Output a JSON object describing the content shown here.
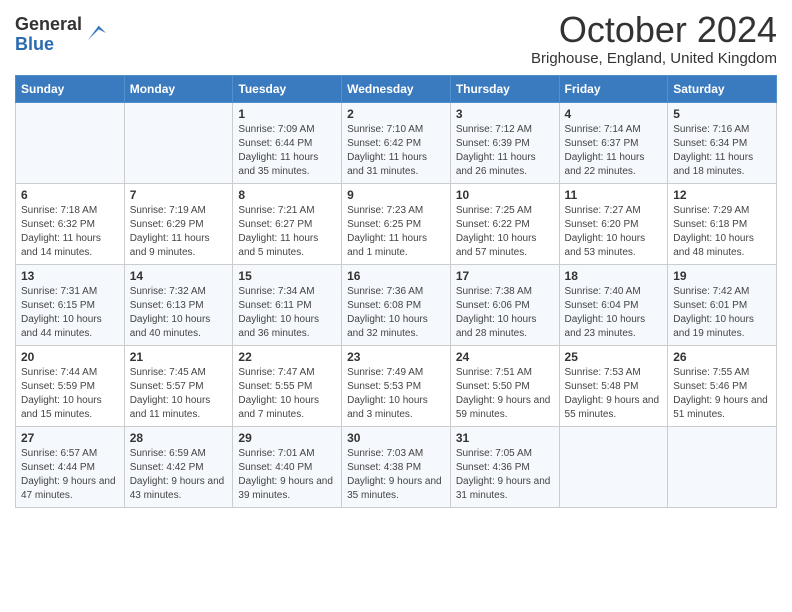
{
  "logo": {
    "general": "General",
    "blue": "Blue"
  },
  "header": {
    "month": "October 2024",
    "location": "Brighouse, England, United Kingdom"
  },
  "weekdays": [
    "Sunday",
    "Monday",
    "Tuesday",
    "Wednesday",
    "Thursday",
    "Friday",
    "Saturday"
  ],
  "weeks": [
    [
      {
        "day": "",
        "info": ""
      },
      {
        "day": "",
        "info": ""
      },
      {
        "day": "1",
        "info": "Sunrise: 7:09 AM\nSunset: 6:44 PM\nDaylight: 11 hours and 35 minutes."
      },
      {
        "day": "2",
        "info": "Sunrise: 7:10 AM\nSunset: 6:42 PM\nDaylight: 11 hours and 31 minutes."
      },
      {
        "day": "3",
        "info": "Sunrise: 7:12 AM\nSunset: 6:39 PM\nDaylight: 11 hours and 26 minutes."
      },
      {
        "day": "4",
        "info": "Sunrise: 7:14 AM\nSunset: 6:37 PM\nDaylight: 11 hours and 22 minutes."
      },
      {
        "day": "5",
        "info": "Sunrise: 7:16 AM\nSunset: 6:34 PM\nDaylight: 11 hours and 18 minutes."
      }
    ],
    [
      {
        "day": "6",
        "info": "Sunrise: 7:18 AM\nSunset: 6:32 PM\nDaylight: 11 hours and 14 minutes."
      },
      {
        "day": "7",
        "info": "Sunrise: 7:19 AM\nSunset: 6:29 PM\nDaylight: 11 hours and 9 minutes."
      },
      {
        "day": "8",
        "info": "Sunrise: 7:21 AM\nSunset: 6:27 PM\nDaylight: 11 hours and 5 minutes."
      },
      {
        "day": "9",
        "info": "Sunrise: 7:23 AM\nSunset: 6:25 PM\nDaylight: 11 hours and 1 minute."
      },
      {
        "day": "10",
        "info": "Sunrise: 7:25 AM\nSunset: 6:22 PM\nDaylight: 10 hours and 57 minutes."
      },
      {
        "day": "11",
        "info": "Sunrise: 7:27 AM\nSunset: 6:20 PM\nDaylight: 10 hours and 53 minutes."
      },
      {
        "day": "12",
        "info": "Sunrise: 7:29 AM\nSunset: 6:18 PM\nDaylight: 10 hours and 48 minutes."
      }
    ],
    [
      {
        "day": "13",
        "info": "Sunrise: 7:31 AM\nSunset: 6:15 PM\nDaylight: 10 hours and 44 minutes."
      },
      {
        "day": "14",
        "info": "Sunrise: 7:32 AM\nSunset: 6:13 PM\nDaylight: 10 hours and 40 minutes."
      },
      {
        "day": "15",
        "info": "Sunrise: 7:34 AM\nSunset: 6:11 PM\nDaylight: 10 hours and 36 minutes."
      },
      {
        "day": "16",
        "info": "Sunrise: 7:36 AM\nSunset: 6:08 PM\nDaylight: 10 hours and 32 minutes."
      },
      {
        "day": "17",
        "info": "Sunrise: 7:38 AM\nSunset: 6:06 PM\nDaylight: 10 hours and 28 minutes."
      },
      {
        "day": "18",
        "info": "Sunrise: 7:40 AM\nSunset: 6:04 PM\nDaylight: 10 hours and 23 minutes."
      },
      {
        "day": "19",
        "info": "Sunrise: 7:42 AM\nSunset: 6:01 PM\nDaylight: 10 hours and 19 minutes."
      }
    ],
    [
      {
        "day": "20",
        "info": "Sunrise: 7:44 AM\nSunset: 5:59 PM\nDaylight: 10 hours and 15 minutes."
      },
      {
        "day": "21",
        "info": "Sunrise: 7:45 AM\nSunset: 5:57 PM\nDaylight: 10 hours and 11 minutes."
      },
      {
        "day": "22",
        "info": "Sunrise: 7:47 AM\nSunset: 5:55 PM\nDaylight: 10 hours and 7 minutes."
      },
      {
        "day": "23",
        "info": "Sunrise: 7:49 AM\nSunset: 5:53 PM\nDaylight: 10 hours and 3 minutes."
      },
      {
        "day": "24",
        "info": "Sunrise: 7:51 AM\nSunset: 5:50 PM\nDaylight: 9 hours and 59 minutes."
      },
      {
        "day": "25",
        "info": "Sunrise: 7:53 AM\nSunset: 5:48 PM\nDaylight: 9 hours and 55 minutes."
      },
      {
        "day": "26",
        "info": "Sunrise: 7:55 AM\nSunset: 5:46 PM\nDaylight: 9 hours and 51 minutes."
      }
    ],
    [
      {
        "day": "27",
        "info": "Sunrise: 6:57 AM\nSunset: 4:44 PM\nDaylight: 9 hours and 47 minutes."
      },
      {
        "day": "28",
        "info": "Sunrise: 6:59 AM\nSunset: 4:42 PM\nDaylight: 9 hours and 43 minutes."
      },
      {
        "day": "29",
        "info": "Sunrise: 7:01 AM\nSunset: 4:40 PM\nDaylight: 9 hours and 39 minutes."
      },
      {
        "day": "30",
        "info": "Sunrise: 7:03 AM\nSunset: 4:38 PM\nDaylight: 9 hours and 35 minutes."
      },
      {
        "day": "31",
        "info": "Sunrise: 7:05 AM\nSunset: 4:36 PM\nDaylight: 9 hours and 31 minutes."
      },
      {
        "day": "",
        "info": ""
      },
      {
        "day": "",
        "info": ""
      }
    ]
  ]
}
